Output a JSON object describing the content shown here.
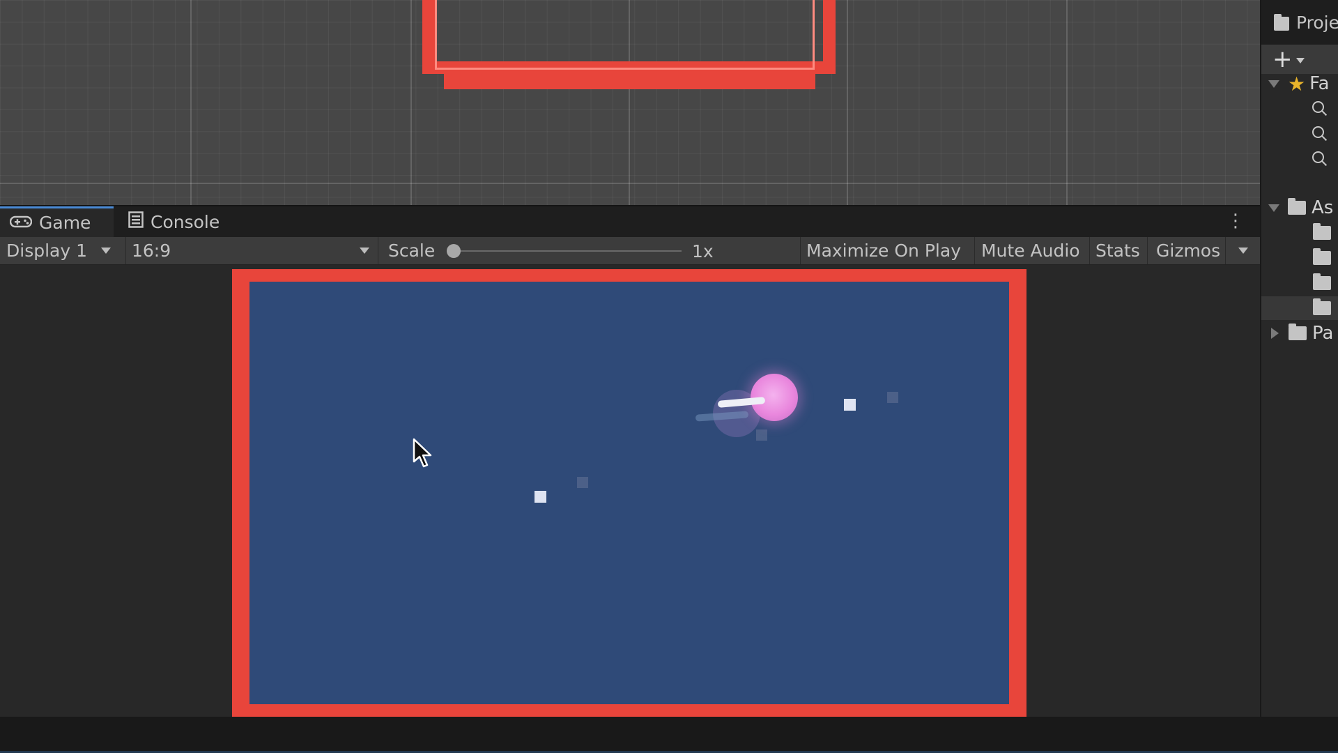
{
  "scene": {},
  "game_tabs": {
    "game_label": "Game",
    "console_label": "Console"
  },
  "game_toolbar": {
    "display": "Display 1",
    "aspect": "16:9",
    "scale_label": "Scale",
    "scale_value": "1x",
    "maximize_on_play": "Maximize On Play",
    "mute_audio": "Mute Audio",
    "stats": "Stats",
    "gizmos": "Gizmos"
  },
  "project": {
    "tab_label": "Proje",
    "favorites_label": "Fa",
    "assets_label": "As",
    "packages_label": "Pa"
  },
  "colors": {
    "highlight_frame": "#e8453b",
    "game_background": "#2f4a78",
    "player_orb": "#e987dd",
    "active_tab_accent": "#4a8ad6"
  },
  "icons": [
    "gamepad-icon",
    "console-icon",
    "kebab-menu-icon",
    "folder-icon",
    "plus-icon",
    "star-icon",
    "search-icon",
    "mouse-cursor-icon"
  ]
}
